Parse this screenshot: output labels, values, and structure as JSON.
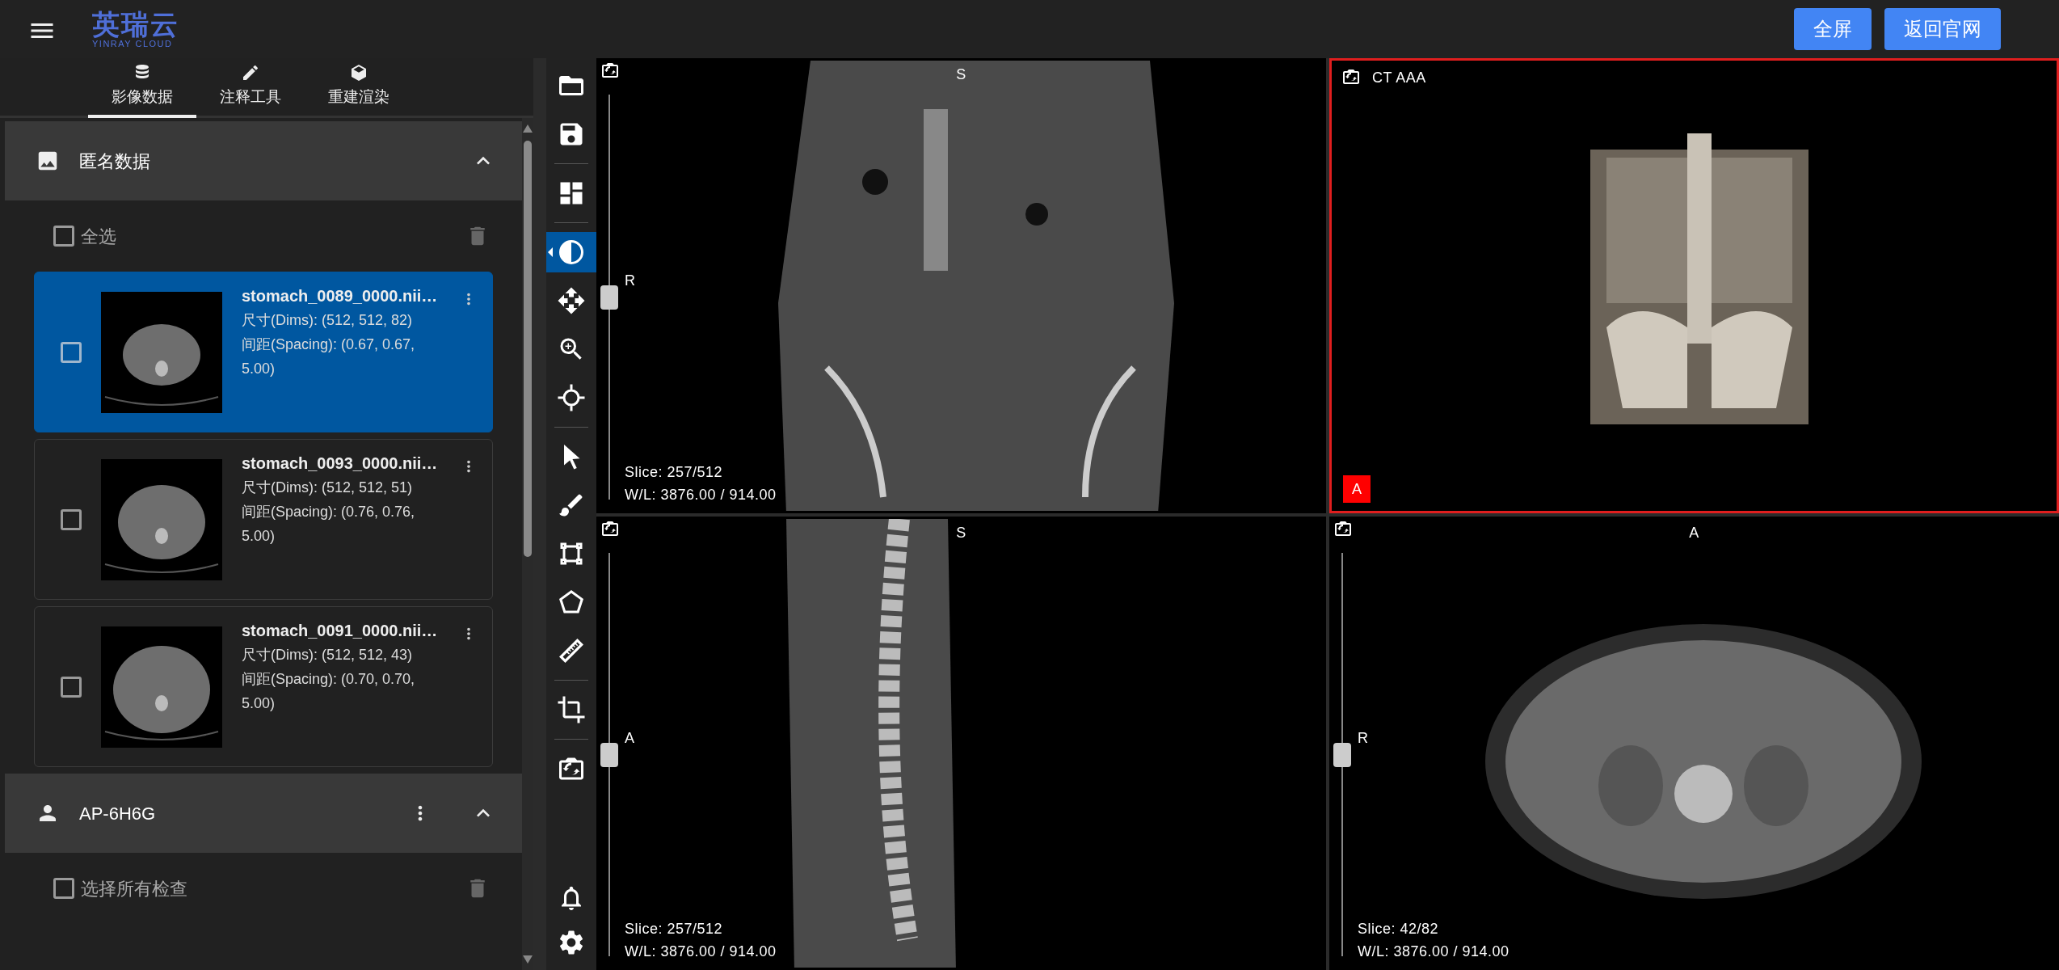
{
  "header": {
    "logo_title": "英瑞云",
    "logo_subtitle": "YINRAY CLOUD",
    "buttons": [
      "全屏",
      "返回官网"
    ]
  },
  "sidebar": {
    "tabs": [
      {
        "kind": "database",
        "label": "影像数据",
        "selected": true
      },
      {
        "kind": "pencil",
        "label": "注释工具",
        "selected": false
      },
      {
        "kind": "cube",
        "label": "重建渲染",
        "selected": false
      }
    ],
    "sections": [
      {
        "kind": "folder",
        "title": "匿名数据",
        "expanded": true,
        "select_all": {
          "label": "全选",
          "checked": false
        },
        "items": [
          {
            "name": "stomach_0089_0000.nii…",
            "dims": "尺寸(Dims): (512, 512, 82)",
            "spacing": "间距(Spacing): (0.67, 0.67, 5.00)",
            "selected": true,
            "checked": false
          },
          {
            "name": "stomach_0093_0000.nii…",
            "dims": "尺寸(Dims): (512, 512, 51)",
            "spacing": "间距(Spacing): (0.76, 0.76, 5.00)",
            "selected": false,
            "checked": false
          },
          {
            "name": "stomach_0091_0000.nii…",
            "dims": "尺寸(Dims): (512, 512, 43)",
            "spacing": "间距(Spacing): (0.70, 0.70, 5.00)",
            "selected": false,
            "checked": false
          }
        ]
      },
      {
        "kind": "patient",
        "title": "AP-6H6G",
        "expanded": true,
        "select_all": {
          "label": "选择所有检查",
          "checked": false
        }
      }
    ]
  },
  "toolbar": {
    "groups": [
      [
        {
          "kind": "folder",
          "selected": false
        },
        {
          "kind": "save",
          "selected": false
        }
      ],
      [
        {
          "kind": "layout",
          "selected": false
        }
      ],
      [
        {
          "kind": "contrast",
          "selected": true
        },
        {
          "kind": "move",
          "selected": false
        },
        {
          "kind": "zoom",
          "selected": false
        },
        {
          "kind": "crosshair",
          "selected": false
        }
      ],
      [
        {
          "kind": "pointer",
          "selected": false
        },
        {
          "kind": "brush",
          "selected": false
        },
        {
          "kind": "bbox",
          "selected": false
        },
        {
          "kind": "polygon",
          "selected": false
        },
        {
          "kind": "ruler",
          "selected": false
        }
      ],
      [
        {
          "kind": "crop",
          "selected": false
        }
      ],
      [
        {
          "kind": "camera",
          "selected": false
        }
      ]
    ],
    "bottom": [
      {
        "kind": "bell",
        "selected": false
      },
      {
        "kind": "gear",
        "selected": false
      }
    ]
  },
  "viewports": [
    {
      "kind": "coronal",
      "active": false,
      "top_label": "S",
      "left_label": "R",
      "level": 0.5,
      "slice": "Slice: 257/512",
      "wl": "W/L: 3876.00 / 914.00"
    },
    {
      "kind": "volume",
      "active": true,
      "title": "CT AAA",
      "badge": "A"
    },
    {
      "kind": "sagittal",
      "active": false,
      "top_label": "S",
      "left_label": "A",
      "level": 0.5,
      "slice": "Slice: 257/512",
      "wl": "W/L: 3876.00 / 914.00"
    },
    {
      "kind": "axial",
      "active": false,
      "top_label": "A",
      "left_label": "R",
      "level": 0.5,
      "slice": "Slice: 42/82",
      "wl": "W/L: 3876.00 / 914.00"
    }
  ]
}
